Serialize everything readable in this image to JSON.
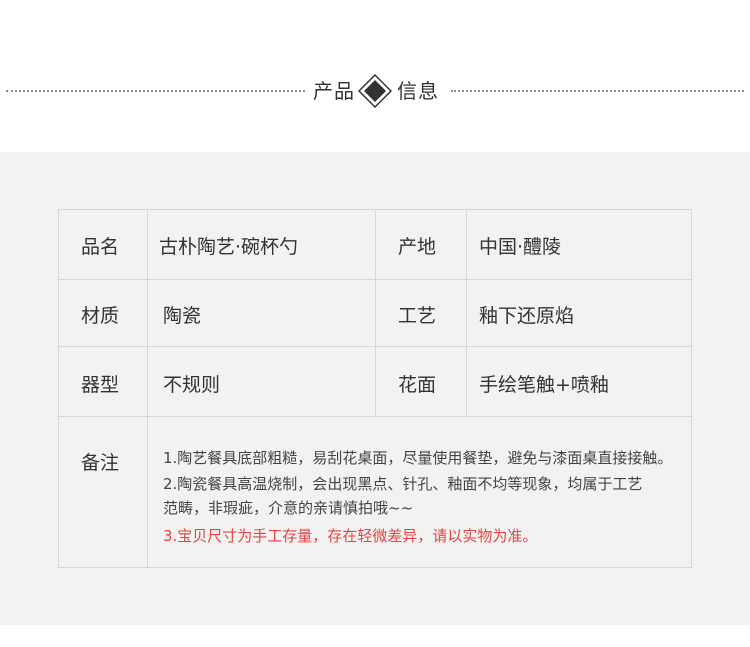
{
  "header": {
    "title_left": "产品",
    "title_right": "信息",
    "diamond_icon": "diamond-icon",
    "colors": {
      "dots": "#8a8a8a",
      "text": "#333333"
    }
  },
  "table": {
    "rows": [
      {
        "label1": "品名",
        "value1": "古朴陶艺·碗杯勺",
        "label2": "产地",
        "value2": "中国·醴陵"
      },
      {
        "label1": "材质",
        "value1": "陶瓷",
        "label2": "工艺",
        "value2": "釉下还原焰"
      },
      {
        "label1": "器型",
        "value1": "不规则",
        "label2": "花面",
        "value2": "手绘笔触+喷釉"
      }
    ],
    "notes_label": "备注",
    "notes": [
      "1.陶艺餐具底部粗糙，易刮花桌面，尽量使用餐垫，避免与漆面桌直接接触。",
      "2.陶瓷餐具高温烧制，会出现黑点、针孔、釉面不均等现象，均属于工艺",
      " 范畴，非瑕疵，介意的亲请慎拍哦~~",
      "3.宝贝尺寸为手工存量，存在轻微差异，请以实物为准。"
    ],
    "colors": {
      "panel_bg": "#f2f2f2",
      "border": "#d6d6d6",
      "warning": "#e8433f"
    }
  }
}
